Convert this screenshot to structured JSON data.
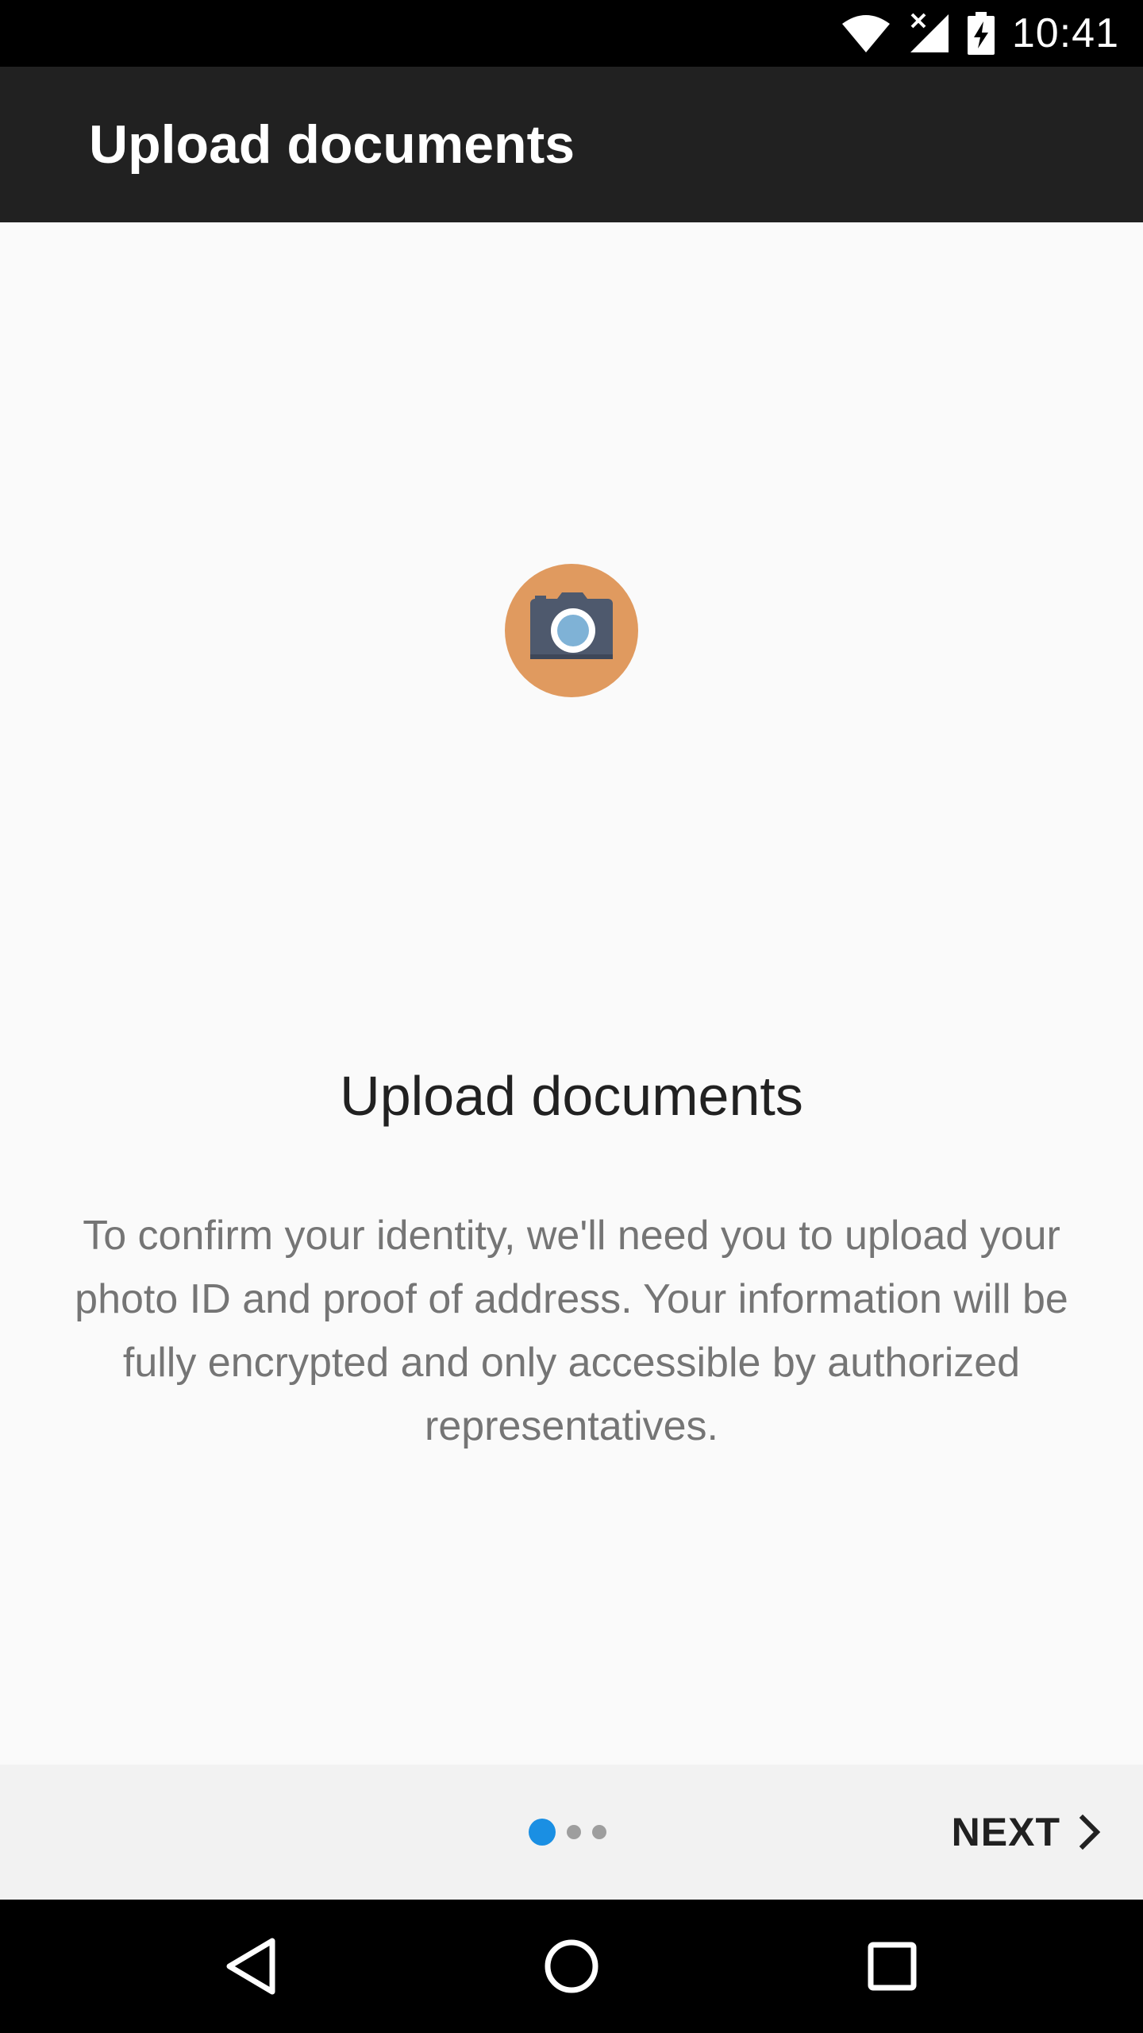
{
  "status_bar": {
    "time": "10:41",
    "icons": [
      "wifi-icon",
      "cellular-signal-icon",
      "battery-charging-icon"
    ]
  },
  "app_bar": {
    "title": "Upload documents"
  },
  "content": {
    "icon": "camera-icon",
    "heading": "Upload documents",
    "body": "To confirm your identity, we'll need you to upload your photo ID and proof of address. Your information will be fully encrypted and only accessible by authorized representatives."
  },
  "pager": {
    "total_pages": 3,
    "current_page": 1
  },
  "next_button": {
    "label": "NEXT",
    "icon": "chevron-right-icon"
  },
  "nav_bar": {
    "buttons": [
      "back-icon",
      "home-icon",
      "recents-icon"
    ]
  },
  "colors": {
    "status_bar": "#000000",
    "app_bar": "#212121",
    "background": "#fafafa",
    "camera_circle": "#e09a5f",
    "active_dot": "#1a8fe3",
    "inactive_dot": "#9e9e9e"
  }
}
